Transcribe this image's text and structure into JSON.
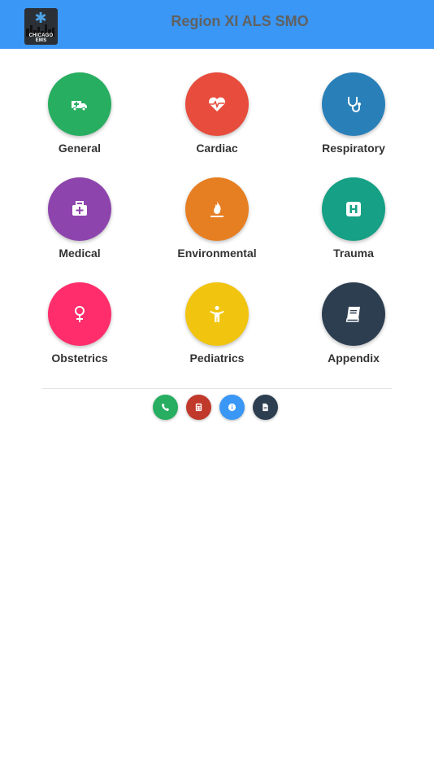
{
  "header": {
    "title": "Region XI ALS SMO",
    "logo_text": "CHICAGO EMS",
    "logo_icon": "star-of-life-icon",
    "background": "#3a97f5"
  },
  "categories": [
    {
      "label": "General",
      "icon": "ambulance-icon",
      "color": "#27ae60"
    },
    {
      "label": "Cardiac",
      "icon": "heartbeat-icon",
      "color": "#e74c3c"
    },
    {
      "label": "Respiratory",
      "icon": "stethoscope-icon",
      "color": "#2980b9"
    },
    {
      "label": "Medical",
      "icon": "medkit-icon",
      "color": "#8e44ad"
    },
    {
      "label": "Environmental",
      "icon": "fire-icon",
      "color": "#e67e22"
    },
    {
      "label": "Trauma",
      "icon": "hospital-icon",
      "color": "#16a085"
    },
    {
      "label": "Obstetrics",
      "icon": "female-icon",
      "color": "#ff2d6b"
    },
    {
      "label": "Pediatrics",
      "icon": "child-icon",
      "color": "#f1c40f"
    },
    {
      "label": "Appendix",
      "icon": "book-icon",
      "color": "#2c3e50"
    }
  ],
  "footer_actions": [
    {
      "icon": "phone-icon",
      "color": "#27ae60"
    },
    {
      "icon": "calculator-icon",
      "color": "#c0392b"
    },
    {
      "icon": "info-icon",
      "color": "#3a97f5"
    },
    {
      "icon": "document-icon",
      "color": "#2c3e50"
    }
  ]
}
